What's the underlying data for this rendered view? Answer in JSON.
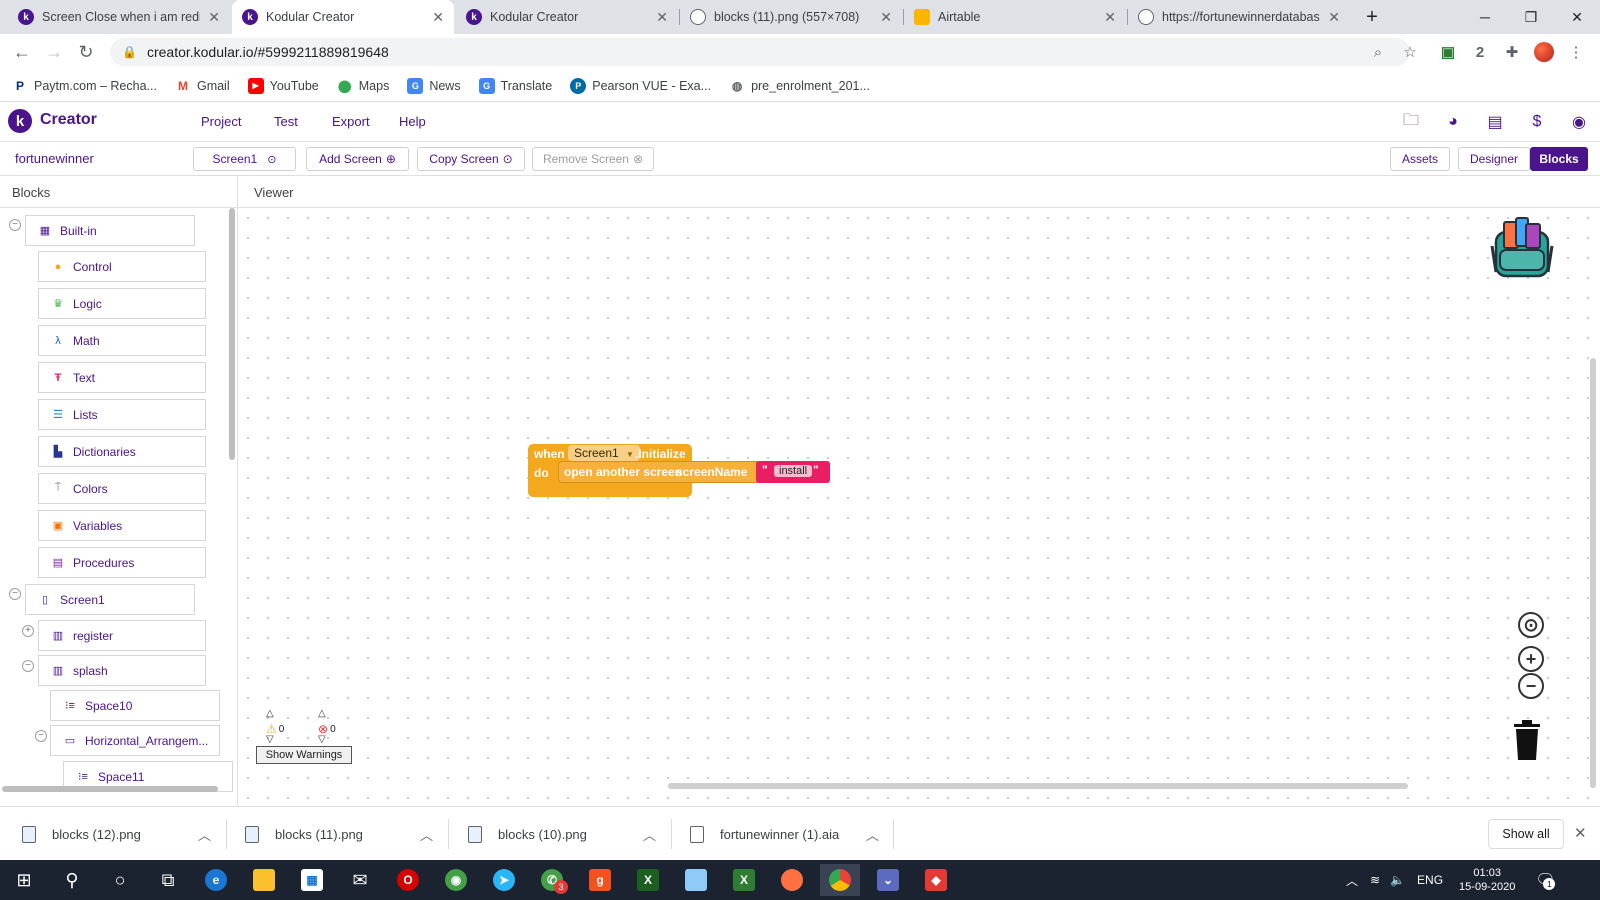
{
  "browser": {
    "tabs": [
      {
        "title": "Screen Close when i am redirec",
        "favicon": "kodular-icon",
        "color": "#4a148c"
      },
      {
        "title": "Kodular Creator",
        "favicon": "kodular-icon",
        "color": "#4a148c",
        "active": true
      },
      {
        "title": "Kodular Creator",
        "favicon": "kodular-icon",
        "color": "#4a148c"
      },
      {
        "title": "blocks (11).png (557×708)",
        "favicon": "globe-icon",
        "color": "#5f6368"
      },
      {
        "title": "Airtable",
        "favicon": "airtable-icon",
        "color": "#fcb400"
      },
      {
        "title": "https://fortunewinnerdatabase",
        "favicon": "globe-icon",
        "color": "#5f6368"
      }
    ],
    "url": "creator.kodular.io/#5999211889819648",
    "bookmarks": [
      {
        "label": "Paytm.com – Recha...",
        "icon": "P",
        "color": "#00baf2"
      },
      {
        "label": "Gmail",
        "icon": "M",
        "color": "#ea4335"
      },
      {
        "label": "YouTube",
        "icon": "▶",
        "color": "#ff0000"
      },
      {
        "label": "Maps",
        "icon": "⬤",
        "color": "#34a853"
      },
      {
        "label": "News",
        "icon": "G",
        "color": "#4285f4"
      },
      {
        "label": "Translate",
        "icon": "G",
        "color": "#4285f4"
      },
      {
        "label": "Pearson VUE - Exa...",
        "icon": "P",
        "color": "#006ba6"
      },
      {
        "label": "pre_enrolment_201...",
        "icon": "◍",
        "color": "#5f6368"
      }
    ]
  },
  "kodular": {
    "brand": "Creator",
    "menu": [
      "Project",
      "Test",
      "Export",
      "Help"
    ],
    "project_name": "fortunewinner",
    "toolbar": {
      "screen": "Screen1",
      "add_screen": "Add Screen",
      "copy_screen": "Copy Screen",
      "remove_screen": "Remove Screen"
    },
    "view_buttons": {
      "assets": "Assets",
      "designer": "Designer",
      "blocks": "Blocks"
    },
    "blocks_title": "Blocks",
    "viewer_title": "Viewer",
    "builtin_label": "Built-in",
    "builtin": [
      {
        "label": "Control",
        "color": "#f4a81d"
      },
      {
        "label": "Logic",
        "color": "#4caf50"
      },
      {
        "label": "Math",
        "color": "#1565c0"
      },
      {
        "label": "Text",
        "color": "#e91e63"
      },
      {
        "label": "Lists",
        "color": "#1e88e5"
      },
      {
        "label": "Dictionaries",
        "color": "#283593"
      },
      {
        "label": "Colors",
        "color": "#757575"
      },
      {
        "label": "Variables",
        "color": "#ff6f00"
      },
      {
        "label": "Procedures",
        "color": "#7b1fa2"
      }
    ],
    "components": {
      "screen": "Screen1",
      "register": "register",
      "splash": "splash",
      "space10": "Space10",
      "horizontal": "Horizontal_Arrangem...",
      "space11": "Space11"
    },
    "block": {
      "when": "when",
      "component": "Screen1",
      "event": ".Initialize",
      "do": "do",
      "call": "open another screen",
      "param": "screenName",
      "string_value": "install"
    },
    "warnings": {
      "warn_count": "0",
      "error_count": "0",
      "button": "Show Warnings"
    }
  },
  "downloads": {
    "items": [
      {
        "name": "blocks (12).png"
      },
      {
        "name": "blocks (11).png"
      },
      {
        "name": "blocks (10).png"
      },
      {
        "name": "fortunewinner (1).aia"
      }
    ],
    "show_all": "Show all"
  },
  "taskbar": {
    "language": "ENG",
    "time": "01:03",
    "date": "15-09-2020",
    "notification_count": "1",
    "whatsapp_badge": "3"
  }
}
